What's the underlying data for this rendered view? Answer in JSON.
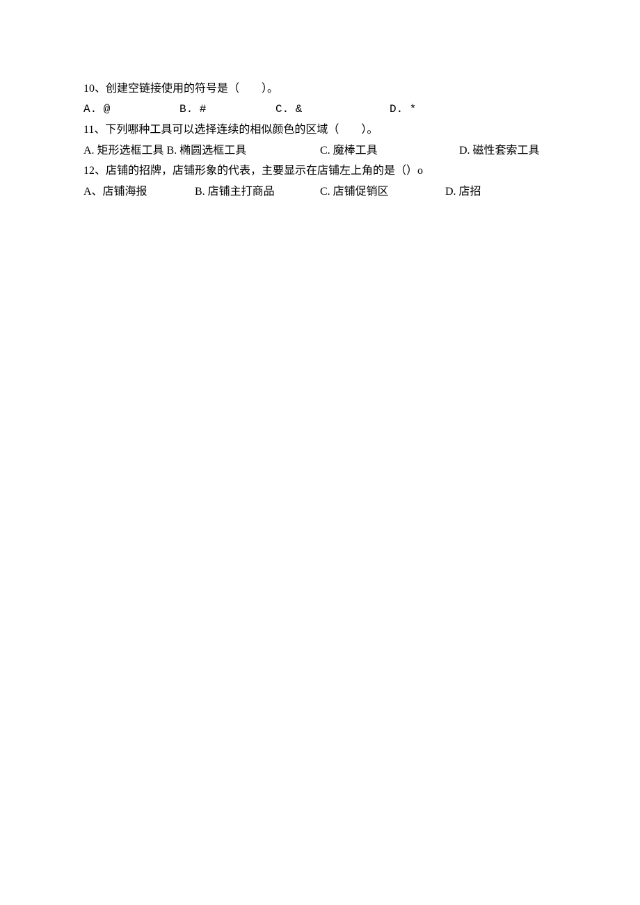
{
  "questions": [
    {
      "q_text": "10、创建空链接使用的符号是（　　）。",
      "options": {
        "a": "A. @",
        "b": "B. #",
        "c": "C. &",
        "d": "D. *"
      }
    },
    {
      "q_text": "11、下列哪种工具可以选择连续的相似颜色的区域（　　）。",
      "options": {
        "a": "A. 矩形选框工具 B. 椭圆选框工具",
        "c": "C. 魔棒工具",
        "d": "D. 磁性套索工具"
      }
    },
    {
      "q_text": "12、店铺的招牌，店铺形象的代表，主要显示在店铺左上角的是（）o",
      "options": {
        "a": "A、店铺海报",
        "b": "B. 店铺主打商品",
        "c": "C. 店铺促销区",
        "d": "D. 店招"
      }
    }
  ]
}
